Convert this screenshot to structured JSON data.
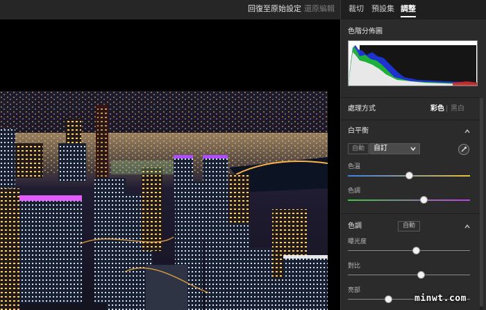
{
  "toolbar": {
    "revert_label": "回復至原始設定",
    "undo_label": "還原編輯"
  },
  "tabs": {
    "crop": "裁切",
    "presets": "預設集",
    "adjust": "調整"
  },
  "histogram": {
    "title": "色階分佈圖"
  },
  "processing": {
    "title": "處理方式",
    "color_label": "彩色",
    "separator": "|",
    "bw_label": "黑白"
  },
  "white_balance": {
    "title": "白平衡",
    "auto_label": "自動",
    "selected": "自訂",
    "temperature": {
      "label": "色溫",
      "value": 0.5
    },
    "tint": {
      "label": "色調",
      "value": 0.62
    }
  },
  "tone": {
    "title": "色調",
    "auto_label": "自動",
    "exposure": {
      "label": "曝光度",
      "value": 0.56
    },
    "contrast": {
      "label": "對比",
      "value": 0.6
    },
    "highlights": {
      "label": "亮部",
      "value": 0.33
    }
  },
  "watermark": {
    "text": "minwt.com"
  }
}
